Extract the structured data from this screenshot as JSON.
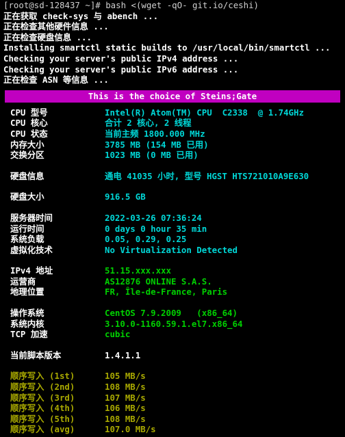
{
  "terminal": {
    "title": "bench.sh / check-sys terminal output",
    "background_color": "#000000",
    "banner_color": "#c000c0",
    "colors": {
      "prompt": "#cfcfcf",
      "label": "#ffffff",
      "cyan": "#00d7d7",
      "green": "#00d000",
      "yellow": "#a8a800",
      "white": "#ffffff",
      "magenta": "#c000c0"
    }
  },
  "log": [
    {
      "text": "[root@sd-128437 ~]# bash <(wget -qO- git.io/ceshi)",
      "style": "prompt"
    },
    {
      "text": "正在获取 check-sys 与 abench ...",
      "style": "zh"
    },
    {
      "text": "正在检查其他硬件信息 ...",
      "style": "zh"
    },
    {
      "text": "正在检查硬盘信息 ...",
      "style": "zh"
    },
    {
      "text": "Installing smartctl static builds to /usr/local/bin/smartctl ...",
      "style": "en"
    },
    {
      "text": "Checking your server's public IPv4 address ...",
      "style": "en"
    },
    {
      "text": "Checking your server's public IPv6 address ...",
      "style": "en"
    },
    {
      "text": "正在检查 ASN 等信息 ...",
      "style": "zh"
    }
  ],
  "banner": {
    "text": "This is the choice of Steins;Gate"
  },
  "sections": [
    {
      "name": "cpu-memory",
      "rows": [
        {
          "label": "CPU 型号",
          "value": "Intel(R) Atom(TM) CPU  C2338  @ 1.74GHz",
          "color": "cyan"
        },
        {
          "label": "CPU 核心",
          "value": "合计 2 核心, 2 线程",
          "color": "cyan"
        },
        {
          "label": "CPU 状态",
          "value": "当前主频 1800.000 MHz",
          "color": "cyan"
        },
        {
          "label": "内存大小",
          "value": "3785 MB (154 MB 已用)",
          "color": "cyan"
        },
        {
          "label": "交换分区",
          "value": "1023 MB (0 MB 已用)",
          "color": "cyan"
        }
      ]
    },
    {
      "name": "disk-info",
      "rows": [
        {
          "label": "硬盘信息",
          "value": "通电 41035 小时, 型号 HGST HTS721010A9E630",
          "color": "cyan"
        }
      ]
    },
    {
      "name": "disk-size",
      "rows": [
        {
          "label": "硬盘大小",
          "value": "916.5 GB",
          "color": "cyan"
        }
      ]
    },
    {
      "name": "system-status",
      "rows": [
        {
          "label": "服务器时间",
          "value": "2022-03-26 07:36:24",
          "color": "cyan"
        },
        {
          "label": "运行时间",
          "value": "0 days 0 hour 35 min",
          "color": "cyan"
        },
        {
          "label": "系统负载",
          "value": "0.05, 0.29, 0.25",
          "color": "cyan"
        },
        {
          "label": "虚拟化技术",
          "value": "No Virtualization Detected",
          "color": "cyan"
        }
      ]
    },
    {
      "name": "network",
      "rows": [
        {
          "label": "IPv4 地址",
          "value": "51.15.xxx.xxx",
          "color": "green"
        },
        {
          "label": "运营商",
          "value": "AS12876 ONLINE S.A.S.",
          "color": "green"
        },
        {
          "label": "地理位置",
          "value": "FR, Île-de-France, Paris",
          "color": "green"
        }
      ]
    },
    {
      "name": "os",
      "rows": [
        {
          "label": "操作系统",
          "value": "CentOS 7.9.2009   (x86_64)",
          "color": "green"
        },
        {
          "label": "系统内核",
          "value": "3.10.0-1160.59.1.el7.x86_64",
          "color": "green"
        },
        {
          "label": "TCP 加速",
          "value": "cubic",
          "color": "green"
        }
      ]
    },
    {
      "name": "script-version",
      "rows": [
        {
          "label": "当前脚本版本",
          "value": "1.4.1.1",
          "color": "white"
        }
      ]
    },
    {
      "name": "disk-write-speed",
      "label_color": "yellow",
      "rows": [
        {
          "label": "顺序写入 (1st)",
          "value": "105 MB/s",
          "color": "yellow"
        },
        {
          "label": "顺序写入 (2nd)",
          "value": "108 MB/s",
          "color": "yellow"
        },
        {
          "label": "顺序写入 (3rd)",
          "value": "107 MB/s",
          "color": "yellow"
        },
        {
          "label": "顺序写入 (4th)",
          "value": "106 MB/s",
          "color": "yellow"
        },
        {
          "label": "顺序写入 (5th)",
          "value": "108 MB/s",
          "color": "yellow"
        },
        {
          "label": "顺序写入 (avg)",
          "value": "107.0 MB/s",
          "color": "yellow"
        }
      ]
    }
  ]
}
